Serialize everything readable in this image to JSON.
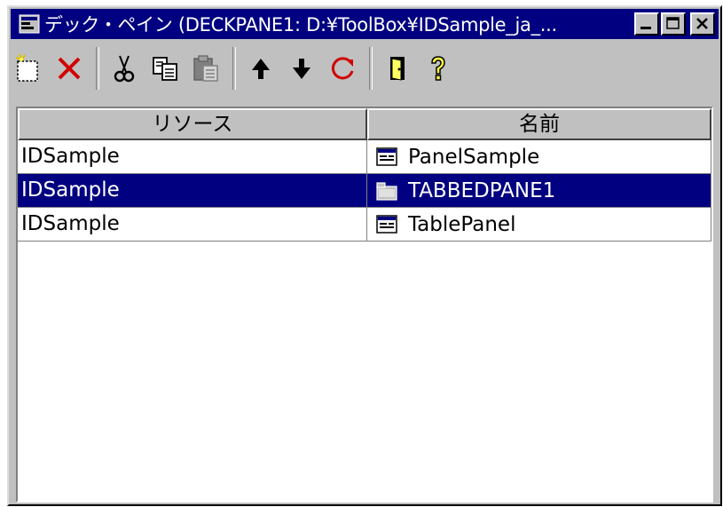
{
  "window": {
    "title": "デック・ペイン (DECKPANE1: D:¥ToolBox¥IDSample_ja_...",
    "icon": "app-window-icon",
    "buttons": [
      "minimize-icon",
      "maximize-icon",
      "close-icon"
    ]
  },
  "toolbar": {
    "items": [
      {
        "name": "new-icon"
      },
      {
        "name": "delete-icon"
      },
      {
        "name": "cut-icon"
      },
      {
        "name": "copy-icon"
      },
      {
        "name": "paste-icon"
      },
      {
        "name": "move-up-icon"
      },
      {
        "name": "move-down-icon"
      },
      {
        "name": "refresh-icon"
      },
      {
        "name": "door-icon"
      },
      {
        "name": "help-icon"
      }
    ]
  },
  "table": {
    "columns": [
      "リソース",
      "名前"
    ],
    "rows": [
      {
        "resource": "IDSample",
        "name": "PanelSample",
        "icon": "panel-icon",
        "selected": false
      },
      {
        "resource": "IDSample",
        "name": "TABBEDPANE1",
        "icon": "tabbed-pane-icon",
        "selected": true
      },
      {
        "resource": "IDSample",
        "name": "TablePanel",
        "icon": "panel-icon",
        "selected": false
      }
    ]
  },
  "colors": {
    "titlebar": "#000080",
    "selection": "#000080",
    "face": "#c0c0c0"
  }
}
